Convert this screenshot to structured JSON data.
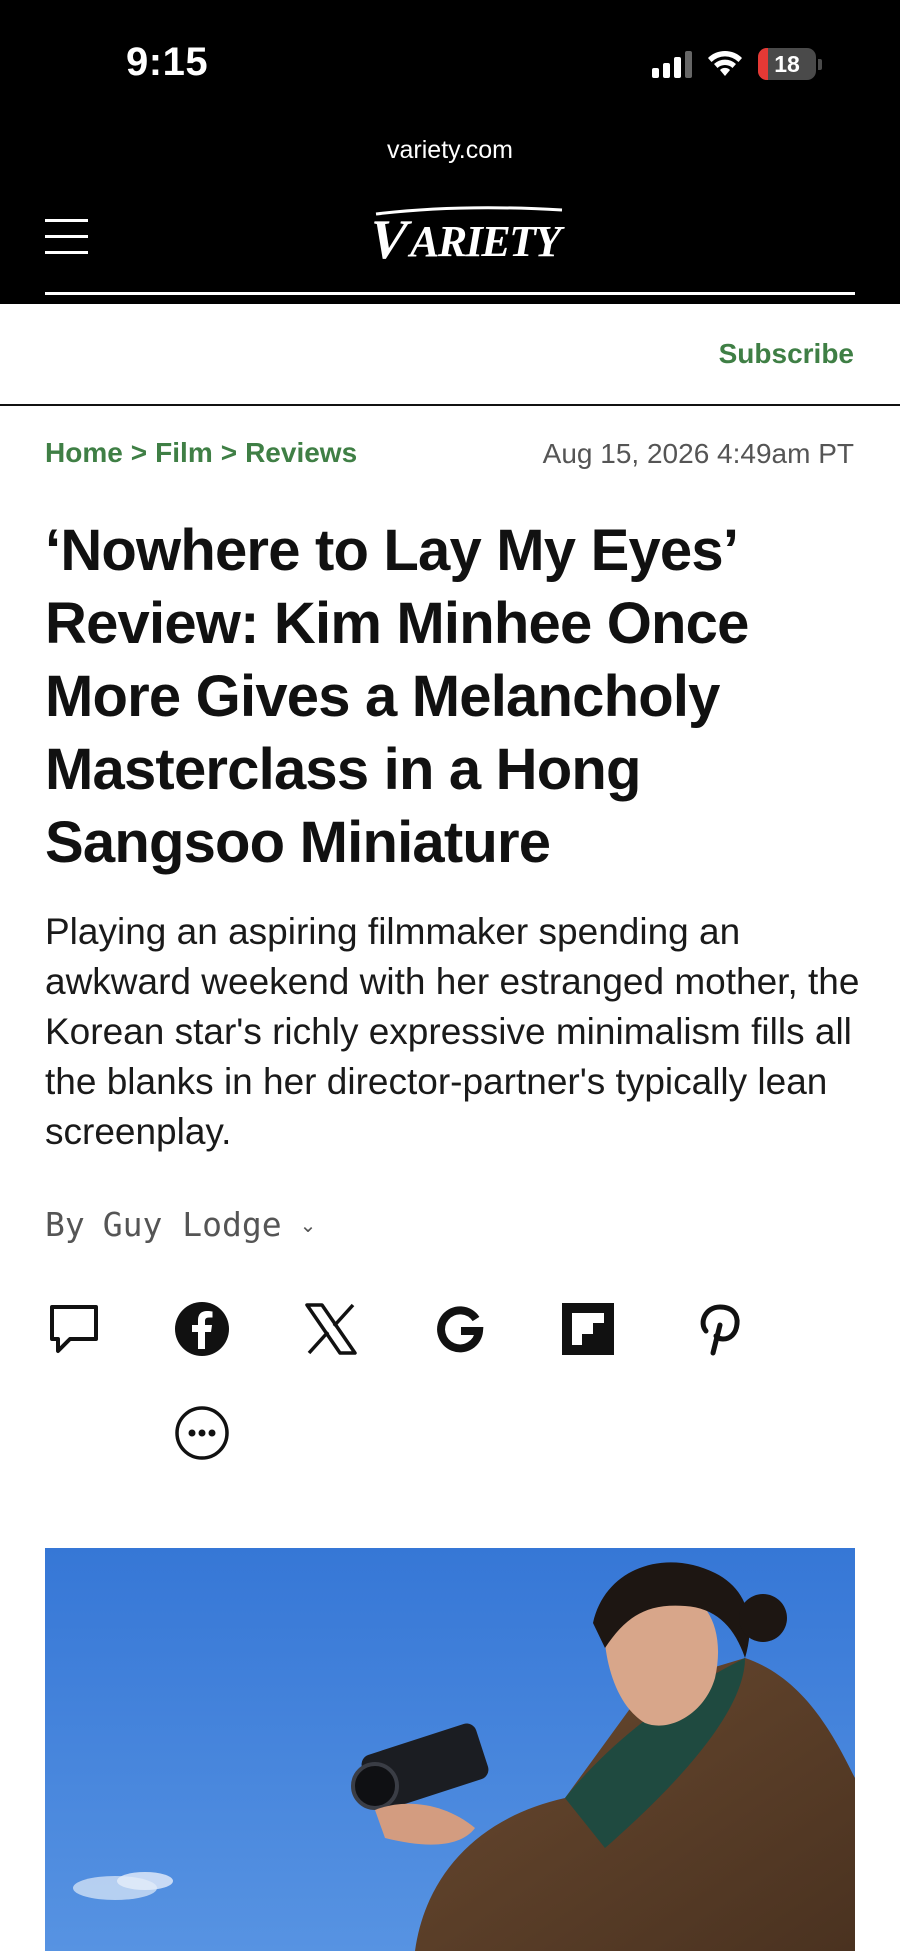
{
  "status_bar": {
    "time": "9:15",
    "battery_level": "18",
    "battery_color": "#e53935"
  },
  "browser": {
    "url": "variety.com"
  },
  "header": {
    "logo_text": "VARIETY",
    "menu_icon": "hamburger-menu-icon",
    "subscribe_label": "Subscribe",
    "accent_color": "#3f7f45"
  },
  "breadcrumb": {
    "items": [
      "Home",
      "Film",
      "Reviews"
    ],
    "separator": ">"
  },
  "article": {
    "timestamp": "Aug 15, 2026 4:49am PT",
    "headline": "‘Nowhere to Lay My Eyes’ Review: Kim Minhee Once More Gives a Melancholy Masterclass in a Hong Sangsoo Miniature",
    "dek": "Playing an aspiring filmmaker spending an awkward weekend with her estranged mother, the Korean star's richly expressive minimalism fills all the blanks in her director-partner's typically lean screenplay.",
    "byline_prefix": "By",
    "author": "Guy Lodge"
  },
  "share_icons": [
    "comment-icon",
    "facebook-icon",
    "x-icon",
    "google-icon",
    "flipboard-icon",
    "pinterest-icon",
    "more-icon"
  ]
}
